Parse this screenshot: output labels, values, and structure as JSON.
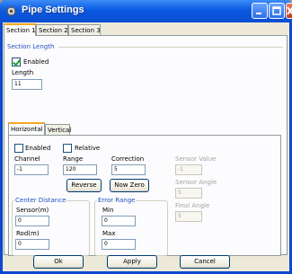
{
  "window": {
    "title": "Pipe Settings"
  },
  "outer_tabs": [
    "Section 1",
    "Section 2",
    "Section 3"
  ],
  "section_length": {
    "title": "Section Length",
    "enabled_label": "Enabled",
    "enabled_checked": true,
    "length_label": "Length",
    "length_value": "11"
  },
  "inner_tabs": [
    "Horizontal",
    "Vertical"
  ],
  "horizontal": {
    "enabled_label": "Enabled",
    "relative_label": "Relative",
    "channel_label": "Channel",
    "channel_value": "-1",
    "range_label": "Range",
    "range_value": "120",
    "correction_label": "Correction",
    "correction_value": "5",
    "reverse_label": "Reverse",
    "now_zero_label": "Now Zero",
    "sensor_value_label": "Sensor Value",
    "sensor_value": "-1",
    "sensor_angle_label": "Sensor Angle",
    "sensor_angle_value": "5",
    "final_angle_label": "Final Angle",
    "final_angle_value": "5",
    "center_distance": {
      "title": "Center Distance",
      "sensor_label": "Sensor(m)",
      "sensor_value": "0",
      "rod_label": "Rod(m)",
      "rod_value": "0"
    },
    "error_range": {
      "title": "Error Range",
      "min_label": "Min",
      "min_value": "0",
      "max_label": "Max",
      "max_value": "0"
    }
  },
  "footer": {
    "ok_label": "Ok",
    "apply_label": "Apply",
    "cancel_label": "Cancel"
  },
  "colors": {
    "title_bar": "#0b59e0",
    "group_title": "#1f4fc0",
    "active_tab_accent": "#f5a623"
  }
}
